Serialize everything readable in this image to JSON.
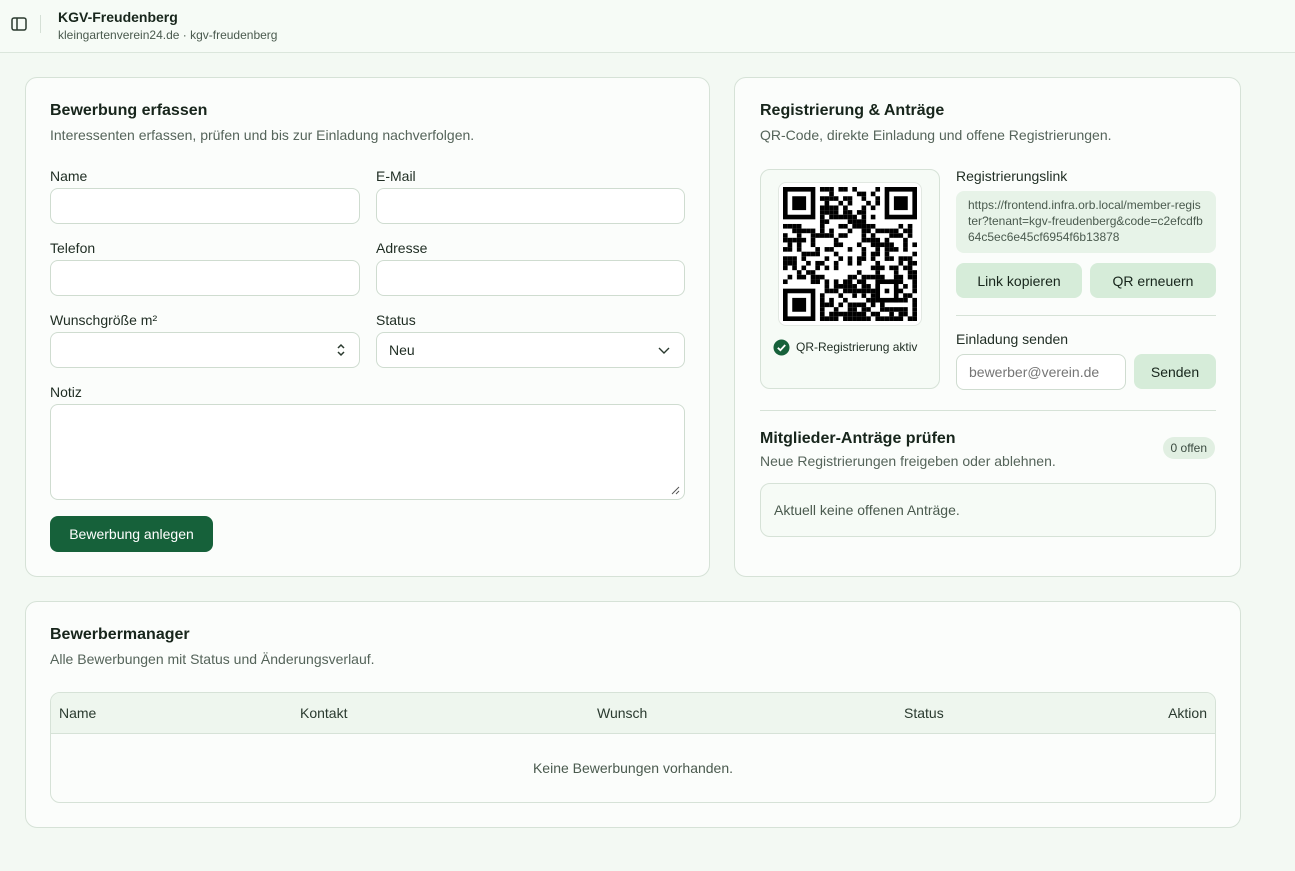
{
  "header": {
    "tenant_name": "KGV-Freudenberg",
    "tenant_sub": "kleingartenverein24.de · kgv-freudenberg"
  },
  "application_form": {
    "title": "Bewerbung erfassen",
    "description": "Interessenten erfassen, prüfen und bis zur Einladung nachverfolgen.",
    "name_label": "Name",
    "name_value": "",
    "email_label": "E-Mail",
    "email_value": "",
    "phone_label": "Telefon",
    "phone_value": "",
    "address_label": "Adresse",
    "address_value": "",
    "size_label": "Wunschgröße m²",
    "size_value": "",
    "status_label": "Status",
    "status_value": "Neu",
    "note_label": "Notiz",
    "note_value": "",
    "submit_label": "Bewerbung anlegen"
  },
  "registration": {
    "title": "Registrierung & Anträge",
    "description": "QR-Code, direkte Einladung und offene Registrierungen.",
    "qr_status": "QR-Registrierung aktiv",
    "link_label": "Registrierungslink",
    "link_value": "https://frontend.infra.orb.local/member-register?tenant=kgv-freudenberg&code=c2efcdfb64c5ec6e45cf6954f6b13878",
    "copy_label": "Link kopieren",
    "renew_label": "QR erneuern",
    "invite_label": "Einladung senden",
    "invite_placeholder": "bewerber@verein.de",
    "send_label": "Senden",
    "colors": {
      "accent": "#16613a",
      "soft": "#d6ecd9"
    }
  },
  "member_requests": {
    "title": "Mitglieder-Anträge prüfen",
    "description": "Neue Registrierungen freigeben oder ablehnen.",
    "badge": "0 offen",
    "empty": "Aktuell keine offenen Anträge."
  },
  "applicant_manager": {
    "title": "Bewerbermanager",
    "description": "Alle Bewerbungen mit Status und Änderungsverlauf.",
    "columns": [
      "Name",
      "Kontakt",
      "Wunsch",
      "Status",
      "Aktion"
    ],
    "empty": "Keine Bewerbungen vorhanden."
  },
  "icons": {
    "sidebar": "sidebar-toggle-icon",
    "check": "check-circle-icon",
    "chevron": "chevron-down-icon",
    "stepper": "stepper-icon"
  }
}
